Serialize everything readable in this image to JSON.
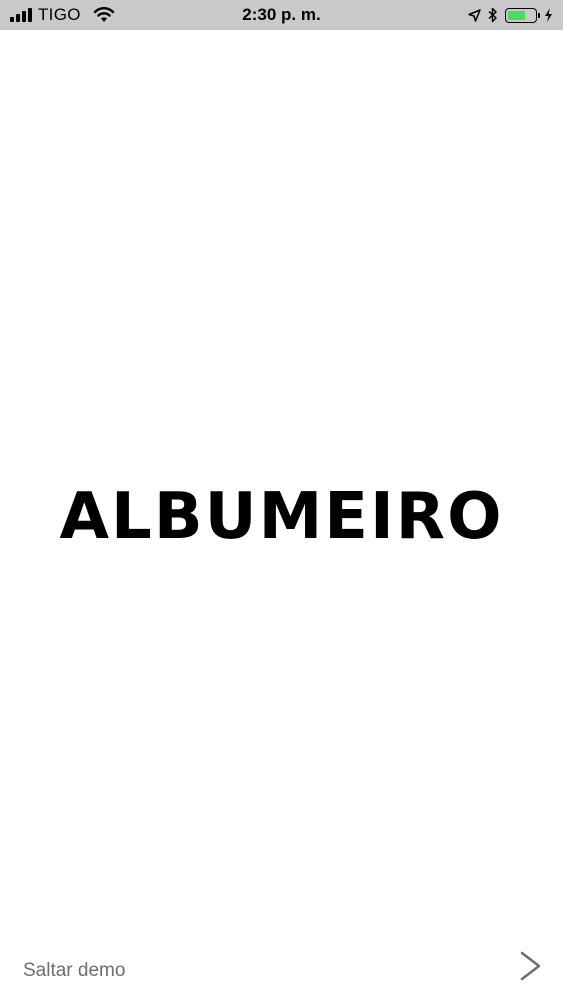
{
  "status_bar": {
    "carrier": "TIGO",
    "time": "2:30 p. m.",
    "battery_level": 0.7
  },
  "logo": {
    "text": "ALBUMEIRO"
  },
  "footer": {
    "skip_label": "Saltar demo",
    "next_icon": "chevron-right-icon"
  },
  "colors": {
    "status_bar_bg": "#c9c9cb",
    "battery_fill": "#4cd964",
    "skip_text": "#6e6e6e"
  }
}
